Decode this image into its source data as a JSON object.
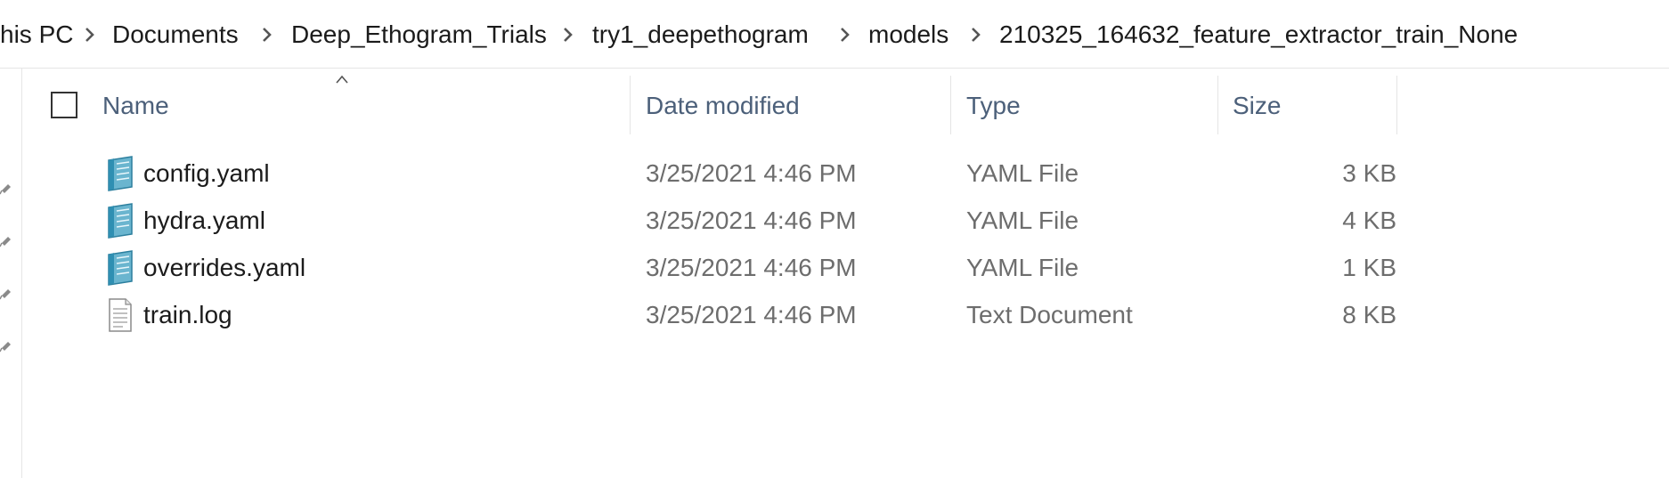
{
  "breadcrumb": {
    "items": [
      "his PC",
      "Documents",
      "Deep_Ethogram_Trials",
      "try1_deepethogram",
      "models",
      "210325_164632_feature_extractor_train_None"
    ]
  },
  "columns": {
    "name": "Name",
    "date_modified": "Date modified",
    "type": "Type",
    "size": "Size"
  },
  "files": [
    {
      "name": "config.yaml",
      "date": "3/25/2021 4:46 PM",
      "type": "YAML File",
      "size": "3 KB",
      "icon": "yaml-file-icon"
    },
    {
      "name": "hydra.yaml",
      "date": "3/25/2021 4:46 PM",
      "type": "YAML File",
      "size": "4 KB",
      "icon": "yaml-file-icon"
    },
    {
      "name": "overrides.yaml",
      "date": "3/25/2021 4:46 PM",
      "type": "YAML File",
      "size": "1 KB",
      "icon": "yaml-file-icon"
    },
    {
      "name": "train.log",
      "date": "3/25/2021 4:46 PM",
      "type": "Text Document",
      "size": "8 KB",
      "icon": "text-file-icon"
    }
  ],
  "colors": {
    "header_text": "#4c607a",
    "detail_text": "#6d6d6d",
    "separator": "#e5e5e5"
  }
}
